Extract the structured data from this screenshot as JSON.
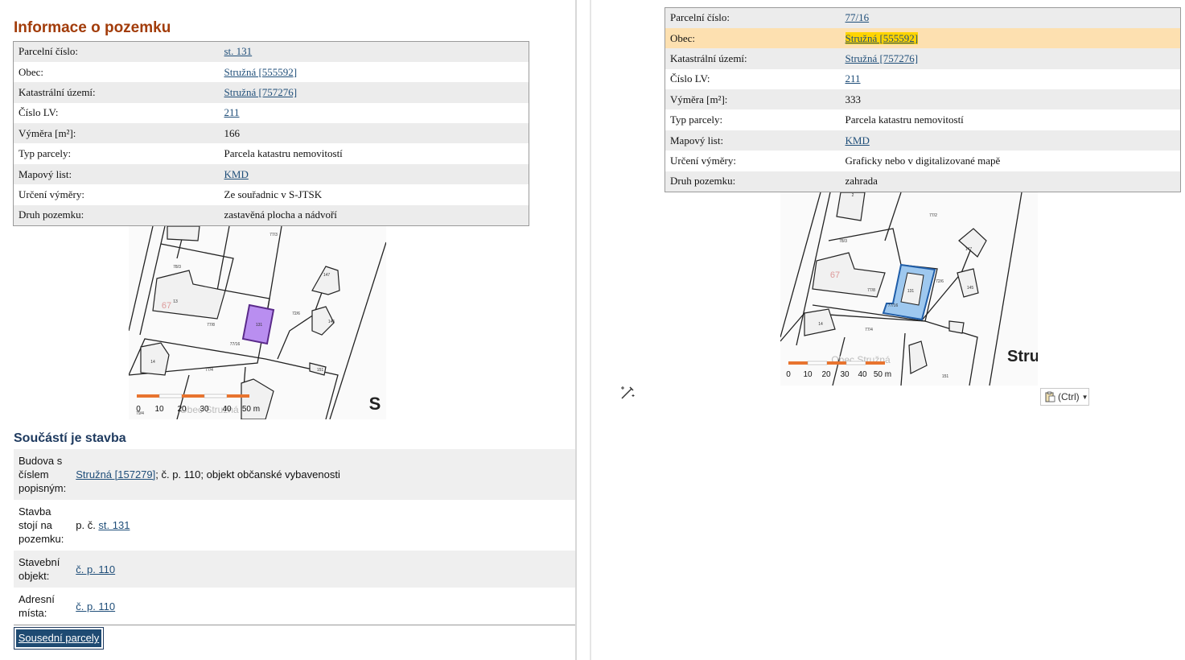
{
  "left": {
    "title": "Informace o pozemku",
    "rows": [
      {
        "label": "Parcelní číslo:",
        "value": "st. 131",
        "link": true
      },
      {
        "label": "Obec:",
        "value": "Stružná [555592]",
        "link": true
      },
      {
        "label": "Katastrální území:",
        "value": "Stružná [757276]",
        "link": true
      },
      {
        "label": "Číslo LV:",
        "value": "211",
        "link": true
      },
      {
        "label": "Výměra [m²]:",
        "value": "166",
        "link": false
      },
      {
        "label": "Typ parcely:",
        "value": "Parcela katastru nemovitostí",
        "link": false
      },
      {
        "label": "Mapový list:",
        "value": "KMD",
        "link": true
      },
      {
        "label": "Určení výměry:",
        "value": "Ze souřadnic v S-JTSK",
        "link": false
      },
      {
        "label": "Druh pozemku:",
        "value": "zastavěná plocha a nádvoří",
        "link": false
      }
    ],
    "map": {
      "labels": [
        "77/3",
        "78/3",
        "13",
        "147",
        "67",
        "77/8",
        "131",
        "145",
        "72/6",
        "77/16",
        "14",
        "77/4",
        "151",
        "79/4",
        "Obec Stružná",
        "S"
      ],
      "scale_ticks": [
        "0",
        "10",
        "20",
        "30",
        "40",
        "50 m"
      ],
      "highlight_color": "#b98ef0"
    },
    "component_title": "Součástí je stavba",
    "component_rows": [
      {
        "label": "Budova s číslem popisným:",
        "link_text": "Stružná [157279]",
        "rest": "; č. p. 110; objekt občanské vybavenosti"
      },
      {
        "label": "Stavba stojí na pozemku:",
        "prefix": "p. č. ",
        "link_text": "st. 131"
      },
      {
        "label": "Stavební objekt:",
        "link_text": "č. p. 110"
      },
      {
        "label": "Adresní místa:",
        "link_text": "č. p. 110"
      }
    ],
    "neighbors_button": "Sousední parcely"
  },
  "right": {
    "rows": [
      {
        "label": "Parcelní číslo:",
        "value": "77/16",
        "link": true
      },
      {
        "label": "Obec:",
        "value": "Stružná [555592]",
        "link": true,
        "highlight": true
      },
      {
        "label": "Katastrální území:",
        "value": "Stružná [757276]",
        "link": true
      },
      {
        "label": "Číslo LV:",
        "value": "211",
        "link": true
      },
      {
        "label": "Výměra [m²]:",
        "value": "333",
        "link": false
      },
      {
        "label": "Typ parcely:",
        "value": "Parcela katastru nemovitostí",
        "link": false
      },
      {
        "label": "Mapový list:",
        "value": "KMD",
        "link": true
      },
      {
        "label": "Určení výměry:",
        "value": "Graficky nebo v digitalizované mapě",
        "link": false
      },
      {
        "label": "Druh pozemku:",
        "value": "zahrada",
        "link": false
      }
    ],
    "map": {
      "labels": [
        "2",
        "77/2",
        "78/3",
        "147",
        "67",
        "131",
        "72/6",
        "77/8",
        "77/16",
        "145",
        "14",
        "77/4",
        "151",
        "Obec Stružná",
        "Stru"
      ],
      "scale_ticks": [
        "0",
        "10",
        "20",
        "30",
        "40",
        "50 m"
      ],
      "highlight_color": "#9ec8ef"
    },
    "paste_button": "(Ctrl)"
  },
  "colors": {
    "heading_primary": "#a23c0a",
    "heading_secondary": "#1e3a5f",
    "link": "#1f4e79",
    "row_highlight": "#fde0b0",
    "text_highlight": "#ffd400"
  }
}
